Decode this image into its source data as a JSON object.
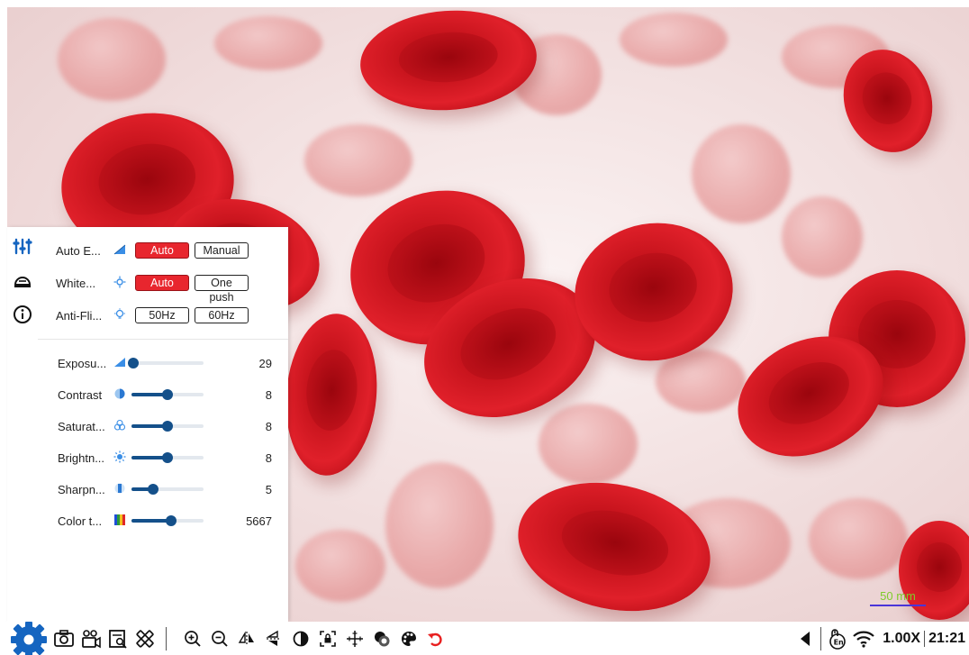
{
  "panel": {
    "tabs": [
      {
        "name": "adjust-tab",
        "icon": "sliders-icon",
        "active": true
      },
      {
        "name": "dome-tab",
        "icon": "dome-icon",
        "active": false
      },
      {
        "name": "info-tab",
        "icon": "info-icon",
        "active": false
      }
    ],
    "modes": [
      {
        "label": "Auto E...",
        "icon": "exposure-icon",
        "options": [
          "Auto",
          "Manual"
        ],
        "active": 0
      },
      {
        "label": "White...",
        "icon": "white-balance-icon",
        "options": [
          "Auto",
          "One push"
        ],
        "active": 0
      },
      {
        "label": "Anti-Fli...",
        "icon": "bulb-icon",
        "options": [
          "50Hz",
          "60Hz"
        ],
        "active": -1
      }
    ],
    "sliders": [
      {
        "label": "Exposu...",
        "icon": "exposure-icon",
        "value": "29",
        "level": 0.02
      },
      {
        "label": "Contrast",
        "icon": "contrast-icon",
        "value": "8",
        "level": 0.5
      },
      {
        "label": "Saturat...",
        "icon": "saturation-icon",
        "value": "8",
        "level": 0.5
      },
      {
        "label": "Brightn...",
        "icon": "brightness-icon",
        "value": "8",
        "level": 0.5
      },
      {
        "label": "Sharpn...",
        "icon": "sharpness-icon",
        "value": "5",
        "level": 0.3
      },
      {
        "label": "Color t...",
        "icon": "color-temperature-icon",
        "value": "5667",
        "level": 0.55
      }
    ]
  },
  "viewer": {
    "scale_label": "50 mm"
  },
  "toolbar": {
    "zoom": "1.00X",
    "clock": "21:21"
  },
  "colors": {
    "accent_red": "#e8262e",
    "slider_blue": "#14508a",
    "settings_blue": "#1565c0",
    "scale_green": "#7ecb2a"
  }
}
